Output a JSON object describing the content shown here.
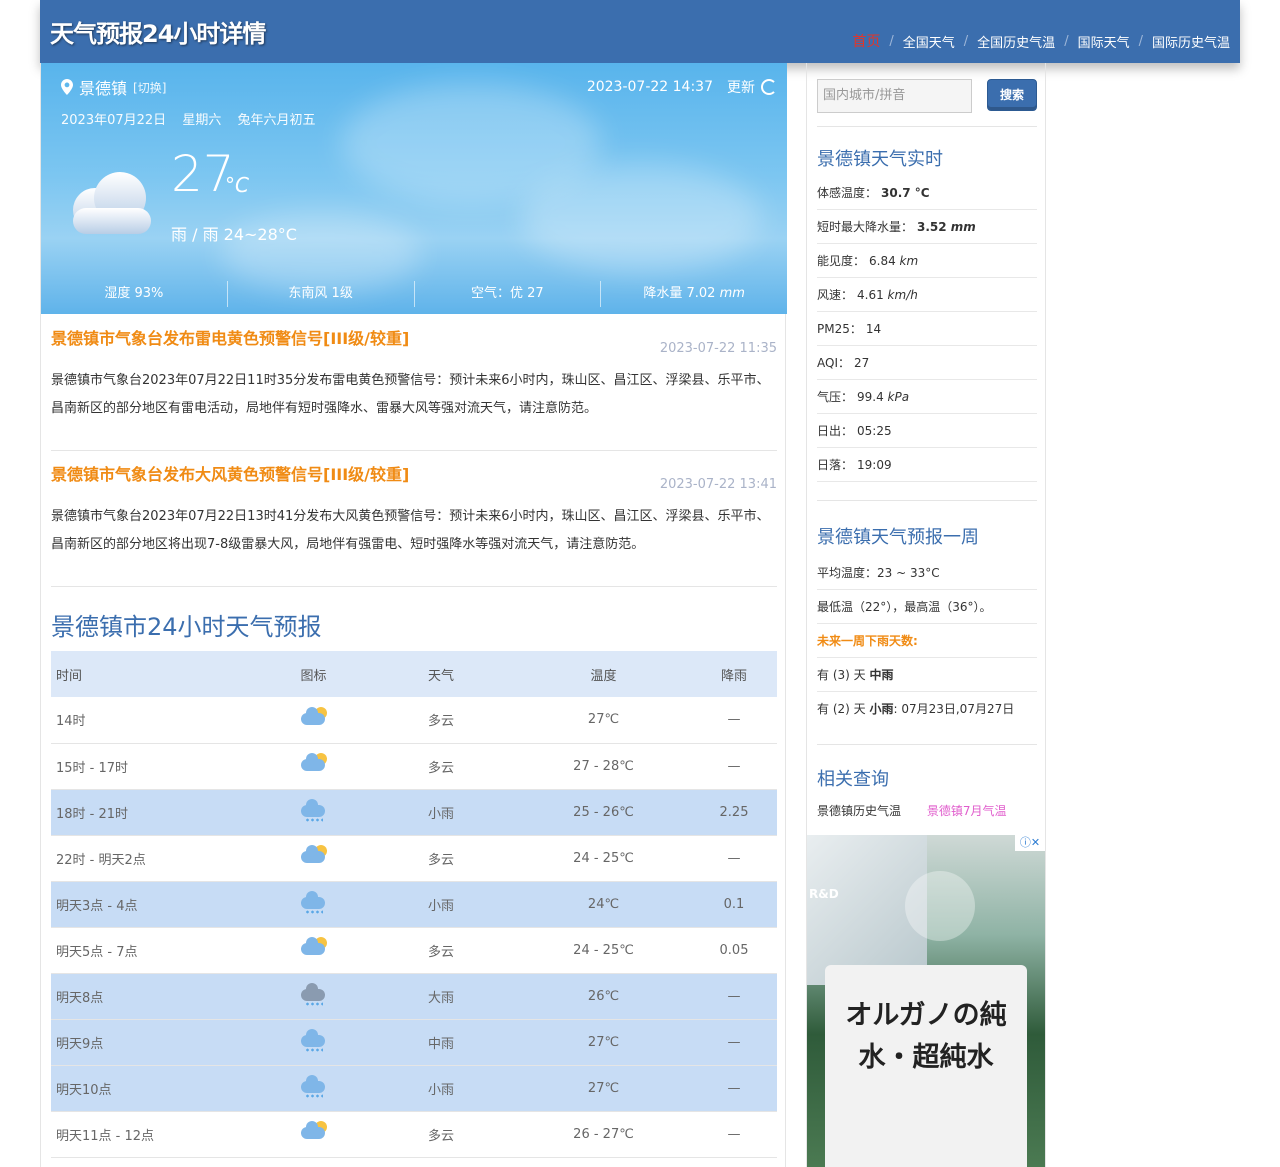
{
  "header": {
    "title": "天气预报24小时详情",
    "nav": [
      "首页",
      "全国天气",
      "全国历史气温",
      "国际天气",
      "国际历史气温"
    ],
    "nav_sep": "/"
  },
  "current": {
    "city": "景德镇",
    "switch": "[切换]",
    "datetime": "2023-07-22 14:37",
    "update": "更新",
    "date": "2023年07月22日",
    "weekday": "星期六",
    "lunar": "兔年六月初五",
    "temp": "27",
    "unit": "°C",
    "desc": "雨 / 雨 24~28°C",
    "humidity": "湿度 93%",
    "wind": "东南风 1级",
    "air": "空气：优 27",
    "rain_label": "降水量 7.02 ",
    "rain_unit": "mm"
  },
  "warnings": [
    {
      "title": "景德镇市气象台发布雷电黄色预警信号[III级/较重]",
      "time": "2023-07-22 11:35",
      "text": "景德镇市气象台2023年07月22日11时35分发布雷电黄色预警信号：预计未来6小时内，珠山区、昌江区、浮梁县、乐平市、昌南新区的部分地区有雷电活动，局地伴有短时强降水、雷暴大风等强对流天气，请注意防范。"
    },
    {
      "title": "景德镇市气象台发布大风黄色预警信号[III级/较重]",
      "time": "2023-07-22 13:41",
      "text": "景德镇市气象台2023年07月22日13时41分发布大风黄色预警信号：预计未来6小时内，珠山区、昌江区、浮梁县、乐平市、昌南新区的部分地区将出现7-8级雷暴大风，局地伴有强雷电、短时强降水等强对流天气，请注意防范。"
    }
  ],
  "forecast": {
    "title": "景德镇市24小时天气预报",
    "headers": [
      "时间",
      "图标",
      "天气",
      "温度",
      "降雨"
    ],
    "rows": [
      {
        "time": "14时",
        "icon": "partly-cloudy-icon",
        "weather": "多云",
        "temp": "27℃",
        "rain": "—"
      },
      {
        "time": "15时 - 17时",
        "icon": "partly-cloudy-icon",
        "weather": "多云",
        "temp": "27 - 28℃",
        "rain": "—"
      },
      {
        "time": "18时 - 21时",
        "icon": "light-rain-icon",
        "weather": "小雨",
        "temp": "25 - 26℃",
        "rain": "2.25"
      },
      {
        "time": "22时 - 明天2点",
        "icon": "partly-cloudy-icon",
        "weather": "多云",
        "temp": "24 - 25℃",
        "rain": "—"
      },
      {
        "time": "明天3点 - 4点",
        "icon": "light-rain-icon",
        "weather": "小雨",
        "temp": "24℃",
        "rain": "0.1"
      },
      {
        "time": "明天5点 - 7点",
        "icon": "partly-cloudy-icon",
        "weather": "多云",
        "temp": "24 - 25℃",
        "rain": "0.05"
      },
      {
        "time": "明天8点",
        "icon": "heavy-rain-icon",
        "weather": "大雨",
        "temp": "26℃",
        "rain": "—"
      },
      {
        "time": "明天9点",
        "icon": "moderate-rain-icon",
        "weather": "中雨",
        "temp": "27℃",
        "rain": "—"
      },
      {
        "time": "明天10点",
        "icon": "light-rain-icon",
        "weather": "小雨",
        "temp": "27℃",
        "rain": "—"
      },
      {
        "time": "明天11点 - 12点",
        "icon": "partly-cloudy-icon",
        "weather": "多云",
        "temp": "26 - 27℃",
        "rain": "—"
      }
    ]
  },
  "sidebar": {
    "search_placeholder": "国内城市/拼音",
    "search_button": "搜索",
    "realtime_title": "景德镇天气实时",
    "realtime": [
      {
        "label": "体感温度：",
        "value": "30.7",
        "unit": " °C",
        "bold": true
      },
      {
        "label": "短时最大降水量：",
        "value": "3.52",
        "unit": " mm",
        "bold": true
      },
      {
        "label": "能见度：",
        "value": "6.84",
        "unit": " km",
        "bold": false
      },
      {
        "label": "风速：",
        "value": "4.61",
        "unit": " km/h",
        "bold": false
      },
      {
        "label": "PM25：",
        "value": "14",
        "unit": "",
        "bold": false
      },
      {
        "label": "AQI：",
        "value": "27",
        "unit": "",
        "bold": false
      },
      {
        "label": "气压：",
        "value": "99.4",
        "unit": " kPa",
        "bold": false
      },
      {
        "label": "日出：",
        "value": "05:25",
        "unit": "",
        "bold": false
      },
      {
        "label": "日落：",
        "value": "19:09",
        "unit": "",
        "bold": false
      }
    ],
    "week_title": "景德镇天气预报一周",
    "avg_temp": "平均温度：23 ~ 33°C",
    "min_max": "最低温（22°），最高温（36°）。",
    "rain_days_title": "未来一周下雨天数:",
    "rain_days_1_pre": "有 (3) 天 ",
    "rain_days_1_type": "中雨",
    "rain_days_2_pre": "有 (2) 天 ",
    "rain_days_2_type": "小雨",
    "rain_days_2_dates": ": 07月23日,07月27日",
    "related_title": "相关查询",
    "related_links": [
      "景德镇历史气温",
      "景德镇7月气温"
    ]
  },
  "ad": {
    "label": "R&D",
    "text": "オルガノの純水・超純水"
  }
}
